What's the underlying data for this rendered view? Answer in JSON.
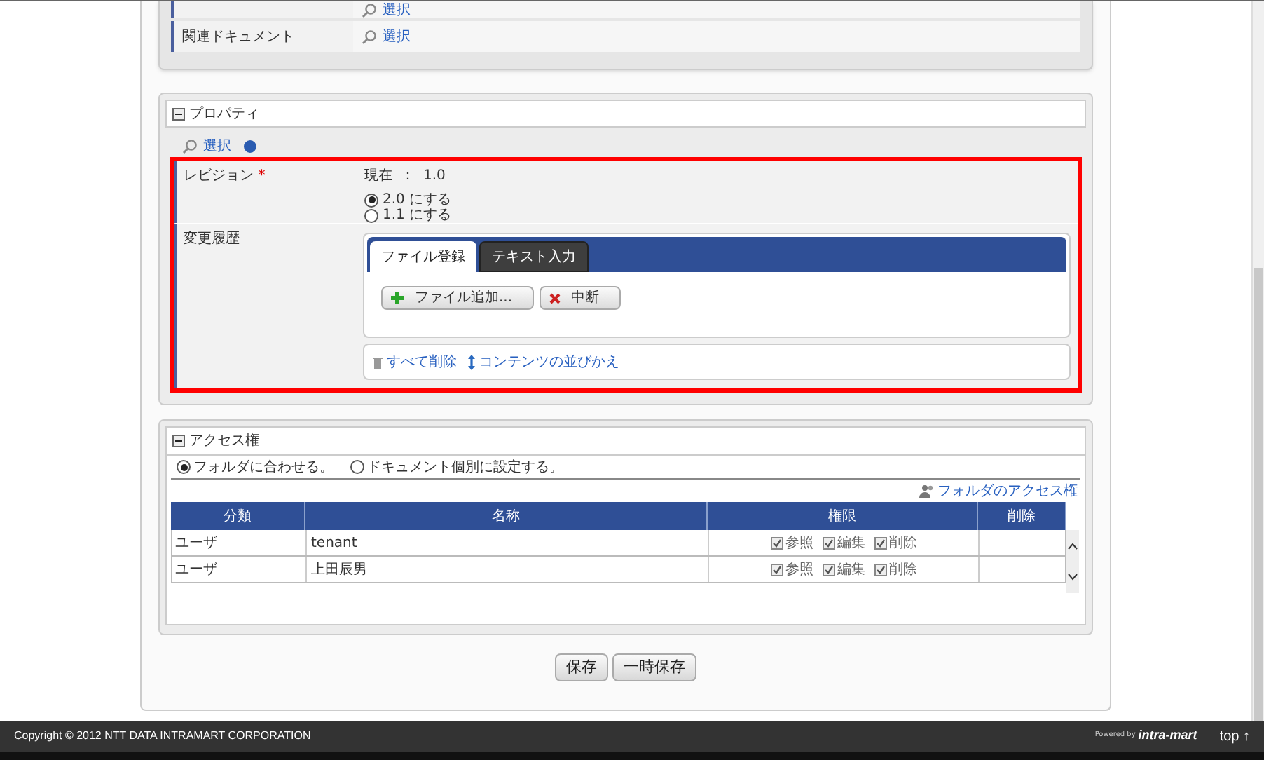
{
  "top_section": {
    "rows": [
      {
        "value": "選択"
      },
      {
        "label": "関連ドキュメント",
        "value": "選択"
      }
    ]
  },
  "properties": {
    "title": "プロパティ",
    "expanded": true,
    "select_link": "選択",
    "revision": {
      "label": "レビジョン",
      "required_mark": "*",
      "current_label": "現在",
      "separator": "：",
      "current_value": "1.0",
      "options": [
        {
          "label": "2.0 にする",
          "selected": true
        },
        {
          "label": "1.1 にする",
          "selected": false
        }
      ]
    },
    "history": {
      "label": "変更履歴",
      "tabs": [
        {
          "label": "ファイル登録",
          "selected": true
        },
        {
          "label": "テキスト入力",
          "selected": false
        }
      ],
      "buttons": [
        {
          "kind": "add",
          "label": "ファイル追加..."
        },
        {
          "kind": "stop",
          "label": "中断"
        }
      ],
      "links": [
        {
          "kind": "delete",
          "label": "すべて削除"
        },
        {
          "kind": "sort",
          "label": "コンテンツの並びかえ"
        }
      ]
    }
  },
  "access": {
    "title": "アクセス権",
    "expanded": true,
    "options": [
      {
        "label": "フォルダに合わせる。",
        "selected": true
      },
      {
        "label": "ドキュメント個別に設定する。",
        "selected": false
      }
    ],
    "folder_link": "フォルダのアクセス権",
    "columns": [
      "分類",
      "名称",
      "権限",
      "削除"
    ],
    "rows": [
      {
        "type": "ユーザ",
        "name": "tenant",
        "permissions": [
          {
            "label": "参照",
            "checked": true
          },
          {
            "label": "編集",
            "checked": true
          },
          {
            "label": "削除",
            "checked": true
          }
        ]
      },
      {
        "type": "ユーザ",
        "name": "上田辰男",
        "permissions": [
          {
            "label": "参照",
            "checked": true
          },
          {
            "label": "編集",
            "checked": true
          },
          {
            "label": "削除",
            "checked": true
          }
        ]
      }
    ]
  },
  "buttons": [
    "保存",
    "一時保存"
  ],
  "footer": {
    "copyright": "Copyright © 2012 NTT DATA INTRAMART CORPORATION",
    "powered_by": "Powered by",
    "logo": "intra-mart",
    "top_link": "top ↑"
  }
}
